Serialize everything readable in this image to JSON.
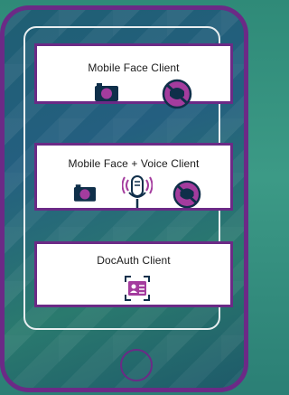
{
  "cards": [
    {
      "title": "Mobile Face Client",
      "icons": [
        "camera-icon",
        "no-mask-icon"
      ]
    },
    {
      "title": "Mobile Face + Voice Client",
      "icons": [
        "camera-icon",
        "microphone-icon",
        "no-mask-icon"
      ]
    },
    {
      "title": "DocAuth Client",
      "icons": [
        "id-card-icon"
      ]
    }
  ],
  "colors": {
    "frame": "#6b2a86",
    "card_bg": "#ffffff",
    "background": "#2f8a78"
  }
}
